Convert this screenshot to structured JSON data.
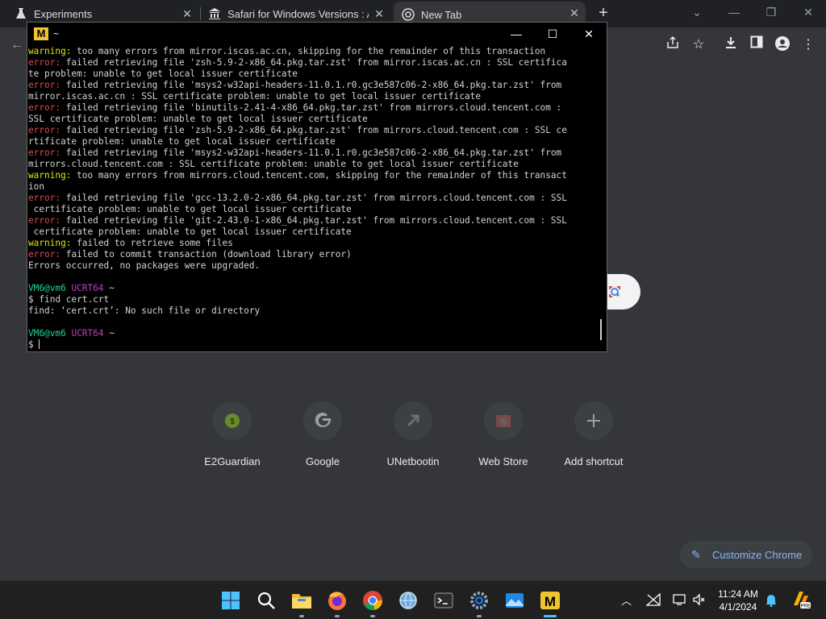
{
  "browser": {
    "tabs": [
      {
        "title": "Experiments",
        "active": false
      },
      {
        "title": "Safari for Windows Versions : Ap",
        "active": false
      },
      {
        "title": "New Tab",
        "active": true
      }
    ],
    "new_tab_icon": "plus-icon",
    "window_controls": [
      "minimize-icon",
      "restore-icon",
      "close-icon"
    ],
    "toolbar_icons": [
      "back-icon",
      "share-icon",
      "star-icon",
      "download-icon",
      "sidepanel-icon",
      "profile-icon",
      "menu-icon"
    ]
  },
  "new_tab_page": {
    "shortcuts": [
      {
        "label": "E2Guardian",
        "icon": "e2guardian-icon"
      },
      {
        "label": "Google",
        "icon": "google-icon"
      },
      {
        "label": "UNetbootin",
        "icon": "unetbootin-icon"
      },
      {
        "label": "Web Store",
        "icon": "webstore-icon"
      },
      {
        "label": "Add shortcut",
        "icon": "plus-icon"
      }
    ],
    "customize_label": "Customize Chrome"
  },
  "terminal": {
    "title": "~",
    "lines": [
      [
        {
          "t": "warning:",
          "c": "warning"
        },
        {
          "t": " too many errors from mirror.iscas.ac.cn, skipping for the remainder of this transaction",
          "c": ""
        }
      ],
      [
        {
          "t": "error:",
          "c": "error"
        },
        {
          "t": " failed retrieving file 'zsh-5.9-2-x86_64.pkg.tar.zst' from mirror.iscas.ac.cn : SSL certifica",
          "c": ""
        }
      ],
      [
        {
          "t": "te problem: unable to get local issuer certificate",
          "c": ""
        }
      ],
      [
        {
          "t": "error:",
          "c": "error"
        },
        {
          "t": " failed retrieving file 'msys2-w32api-headers-11.0.1.r0.gc3e587c06-2-x86_64.pkg.tar.zst' from",
          "c": ""
        }
      ],
      [
        {
          "t": "mirror.iscas.ac.cn : SSL certificate problem: unable to get local issuer certificate",
          "c": ""
        }
      ],
      [
        {
          "t": "error:",
          "c": "error"
        },
        {
          "t": " failed retrieving file 'binutils-2.41-4-x86_64.pkg.tar.zst' from mirrors.cloud.tencent.com :",
          "c": ""
        }
      ],
      [
        {
          "t": "SSL certificate problem: unable to get local issuer certificate",
          "c": ""
        }
      ],
      [
        {
          "t": "error:",
          "c": "error"
        },
        {
          "t": " failed retrieving file 'zsh-5.9-2-x86_64.pkg.tar.zst' from mirrors.cloud.tencent.com : SSL ce",
          "c": ""
        }
      ],
      [
        {
          "t": "rtificate problem: unable to get local issuer certificate",
          "c": ""
        }
      ],
      [
        {
          "t": "error:",
          "c": "error"
        },
        {
          "t": " failed retrieving file 'msys2-w32api-headers-11.0.1.r0.gc3e587c06-2-x86_64.pkg.tar.zst' from",
          "c": ""
        }
      ],
      [
        {
          "t": "mirrors.cloud.tencent.com : SSL certificate problem: unable to get local issuer certificate",
          "c": ""
        }
      ],
      [
        {
          "t": "warning:",
          "c": "warning"
        },
        {
          "t": " too many errors from mirrors.cloud.tencent.com, skipping for the remainder of this transact",
          "c": ""
        }
      ],
      [
        {
          "t": "ion",
          "c": ""
        }
      ],
      [
        {
          "t": "error:",
          "c": "error"
        },
        {
          "t": " failed retrieving file 'gcc-13.2.0-2-x86_64.pkg.tar.zst' from mirrors.cloud.tencent.com : SSL",
          "c": ""
        }
      ],
      [
        {
          "t": " certificate problem: unable to get local issuer certificate",
          "c": ""
        }
      ],
      [
        {
          "t": "error:",
          "c": "error"
        },
        {
          "t": " failed retrieving file 'git-2.43.0-1-x86_64.pkg.tar.zst' from mirrors.cloud.tencent.com : SSL",
          "c": ""
        }
      ],
      [
        {
          "t": " certificate problem: unable to get local issuer certificate",
          "c": ""
        }
      ],
      [
        {
          "t": "warning:",
          "c": "warning"
        },
        {
          "t": " failed to retrieve some files",
          "c": ""
        }
      ],
      [
        {
          "t": "error:",
          "c": "error"
        },
        {
          "t": " failed to commit transaction (download library error)",
          "c": ""
        }
      ],
      [
        {
          "t": "Errors occurred, no packages were upgraded.",
          "c": ""
        }
      ],
      [
        {
          "t": "",
          "c": ""
        }
      ],
      [
        {
          "t": "VM6@vm6",
          "c": "green"
        },
        {
          "t": " ",
          "c": ""
        },
        {
          "t": "UCRT64",
          "c": "purple"
        },
        {
          "t": " ~",
          "c": ""
        }
      ],
      [
        {
          "t": "$ find cert.crt",
          "c": ""
        }
      ],
      [
        {
          "t": "find: ‘cert.crt’: No such file or directory",
          "c": ""
        }
      ],
      [
        {
          "t": "",
          "c": ""
        }
      ],
      [
        {
          "t": "VM6@vm6",
          "c": "green"
        },
        {
          "t": " ",
          "c": ""
        },
        {
          "t": "UCRT64",
          "c": "purple"
        },
        {
          "t": " ~",
          "c": ""
        }
      ],
      [
        {
          "t": "$ ",
          "c": ""
        }
      ]
    ]
  },
  "taskbar": {
    "apps": [
      "start-icon",
      "search-icon",
      "file-explorer-icon",
      "firefox-icon",
      "chrome-icon",
      "network-globe-icon",
      "terminal-icon",
      "settings-icon",
      "photos-icon",
      "msys2-icon"
    ],
    "tray_icons": [
      "chevron-up-icon",
      "network-offline-icon",
      "display-icon",
      "speaker-muted-icon",
      "bell-icon",
      "copilot-pre-icon"
    ],
    "time": "11:24 AM",
    "date": "4/1/2024"
  }
}
